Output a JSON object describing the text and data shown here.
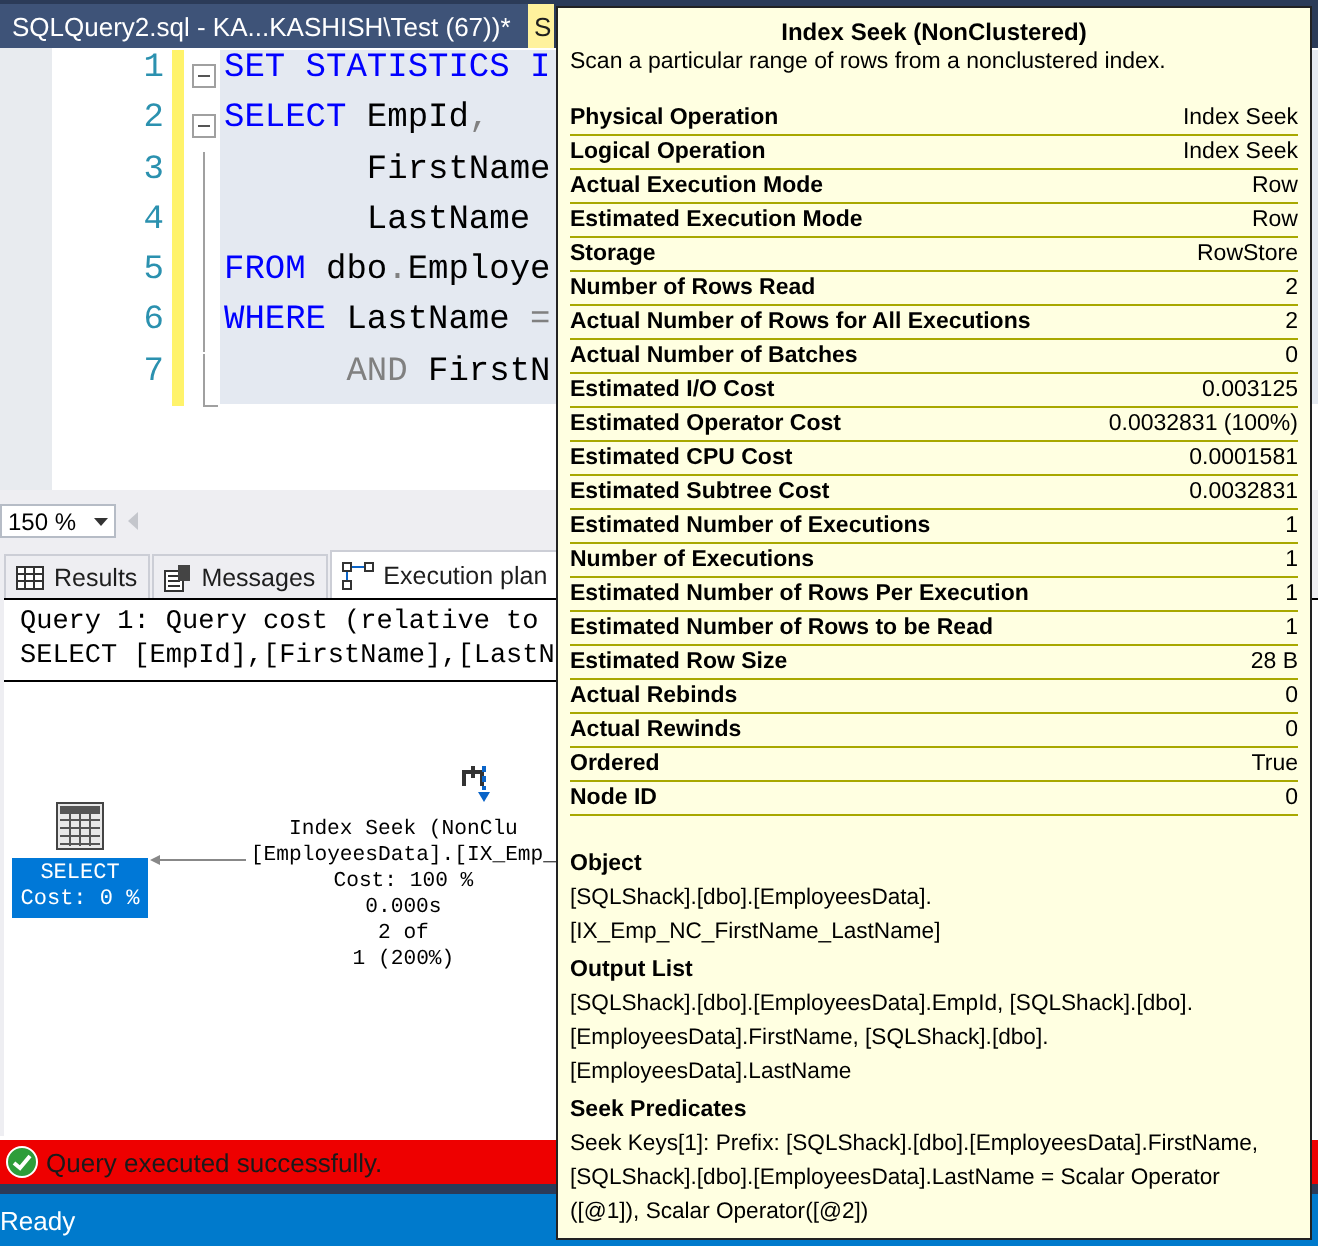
{
  "document_tabs": [
    {
      "label": "SQLQuery2.sql - KA...KASHISH\\Test (67))*",
      "selected": true
    },
    {
      "label": "S",
      "selected": false
    }
  ],
  "editor": {
    "lines": [
      {
        "number": "1",
        "kind": "collapsible",
        "tokens": [
          {
            "text": "SET STATISTICS I",
            "kind": "keyword"
          }
        ]
      },
      {
        "number": "2",
        "kind": "collapsible",
        "tokens": [
          {
            "text": "SELECT",
            "kind": "keyword"
          },
          {
            "text": " EmpId",
            "kind": "plain"
          },
          {
            "text": ",",
            "kind": "punct"
          }
        ]
      },
      {
        "number": "3",
        "kind": "inner",
        "tokens": [
          {
            "text": "       FirstName",
            "kind": "plain"
          }
        ]
      },
      {
        "number": "4",
        "kind": "inner",
        "tokens": [
          {
            "text": "       LastName",
            "kind": "plain"
          }
        ]
      },
      {
        "number": "5",
        "kind": "inner",
        "tokens": [
          {
            "text": "FROM",
            "kind": "keyword"
          },
          {
            "text": " dbo",
            "kind": "plain"
          },
          {
            "text": ".",
            "kind": "punct"
          },
          {
            "text": "Employe",
            "kind": "plain"
          }
        ]
      },
      {
        "number": "6",
        "kind": "inner",
        "tokens": [
          {
            "text": "WHERE",
            "kind": "keyword"
          },
          {
            "text": " LastName ",
            "kind": "plain"
          },
          {
            "text": "=",
            "kind": "punct"
          }
        ]
      },
      {
        "number": "7",
        "kind": "last",
        "tokens": [
          {
            "text": "      AND",
            "kind": "punct"
          },
          {
            "text": " FirstN",
            "kind": "plain"
          }
        ]
      }
    ],
    "zoom": "150 %"
  },
  "result_tabs": [
    {
      "label": "Results",
      "selected": false
    },
    {
      "label": "Messages",
      "selected": false
    },
    {
      "label": "Execution plan",
      "selected": true
    }
  ],
  "plan": {
    "header": [
      "Query 1: Query cost (relative to",
      "SELECT [EmpId],[FirstName],[LastN"
    ],
    "nodes": [
      {
        "kind": "select",
        "lines": [
          "SELECT",
          "Cost: 0 %"
        ],
        "selected": true
      },
      {
        "kind": "index-seek",
        "lines": [
          "Index Seek (NonClu",
          "[EmployeesData].[IX_Emp_",
          "Cost: 100 %",
          "0.000s",
          "2 of",
          "1 (200%)"
        ],
        "selected": false
      }
    ]
  },
  "message": {
    "text": "Query executed successfully."
  },
  "status_bar": {
    "text": "Ready"
  },
  "tooltip": {
    "title": "Index Seek (NonClustered)",
    "description": "Scan a particular range of rows from a nonclustered index.",
    "properties": [
      {
        "label": "Physical Operation",
        "value": "Index Seek"
      },
      {
        "label": "Logical Operation",
        "value": "Index Seek"
      },
      {
        "label": "Actual Execution Mode",
        "value": "Row"
      },
      {
        "label": "Estimated Execution Mode",
        "value": "Row"
      },
      {
        "label": "Storage",
        "value": "RowStore"
      },
      {
        "label": "Number of Rows Read",
        "value": "2"
      },
      {
        "label": "Actual Number of Rows for All Executions",
        "value": "2"
      },
      {
        "label": "Actual Number of Batches",
        "value": "0"
      },
      {
        "label": "Estimated I/O Cost",
        "value": "0.003125"
      },
      {
        "label": "Estimated Operator Cost",
        "value": "0.0032831 (100%)"
      },
      {
        "label": "Estimated CPU Cost",
        "value": "0.0001581"
      },
      {
        "label": "Estimated Subtree Cost",
        "value": "0.0032831"
      },
      {
        "label": "Estimated Number of Executions",
        "value": "1"
      },
      {
        "label": "Number of Executions",
        "value": "1"
      },
      {
        "label": "Estimated Number of Rows Per Execution",
        "value": "1"
      },
      {
        "label": "Estimated Number of Rows to be Read",
        "value": "1"
      },
      {
        "label": "Estimated Row Size",
        "value": "28 B"
      },
      {
        "label": "Actual Rebinds",
        "value": "0"
      },
      {
        "label": "Actual Rewinds",
        "value": "0"
      },
      {
        "label": "Ordered",
        "value": "True"
      },
      {
        "label": "Node ID",
        "value": "0"
      }
    ],
    "sections": [
      {
        "heading": "Object",
        "lines": [
          "[SQLShack].[dbo].[EmployeesData].",
          "[IX_Emp_NC_FirstName_LastName]"
        ]
      },
      {
        "heading": "Output List",
        "lines": [
          "[SQLShack].[dbo].[EmployeesData].EmpId, [SQLShack].[dbo].",
          "[EmployeesData].FirstName, [SQLShack].[dbo].",
          "[EmployeesData].LastName"
        ]
      },
      {
        "heading": "Seek Predicates",
        "lines": [
          "Seek Keys[1]: Prefix: [SQLShack].[dbo].[EmployeesData].FirstName,",
          "[SQLShack].[dbo].[EmployeesData].LastName = Scalar Operator",
          "([@1]), Scalar Operator([@2])"
        ]
      }
    ]
  }
}
